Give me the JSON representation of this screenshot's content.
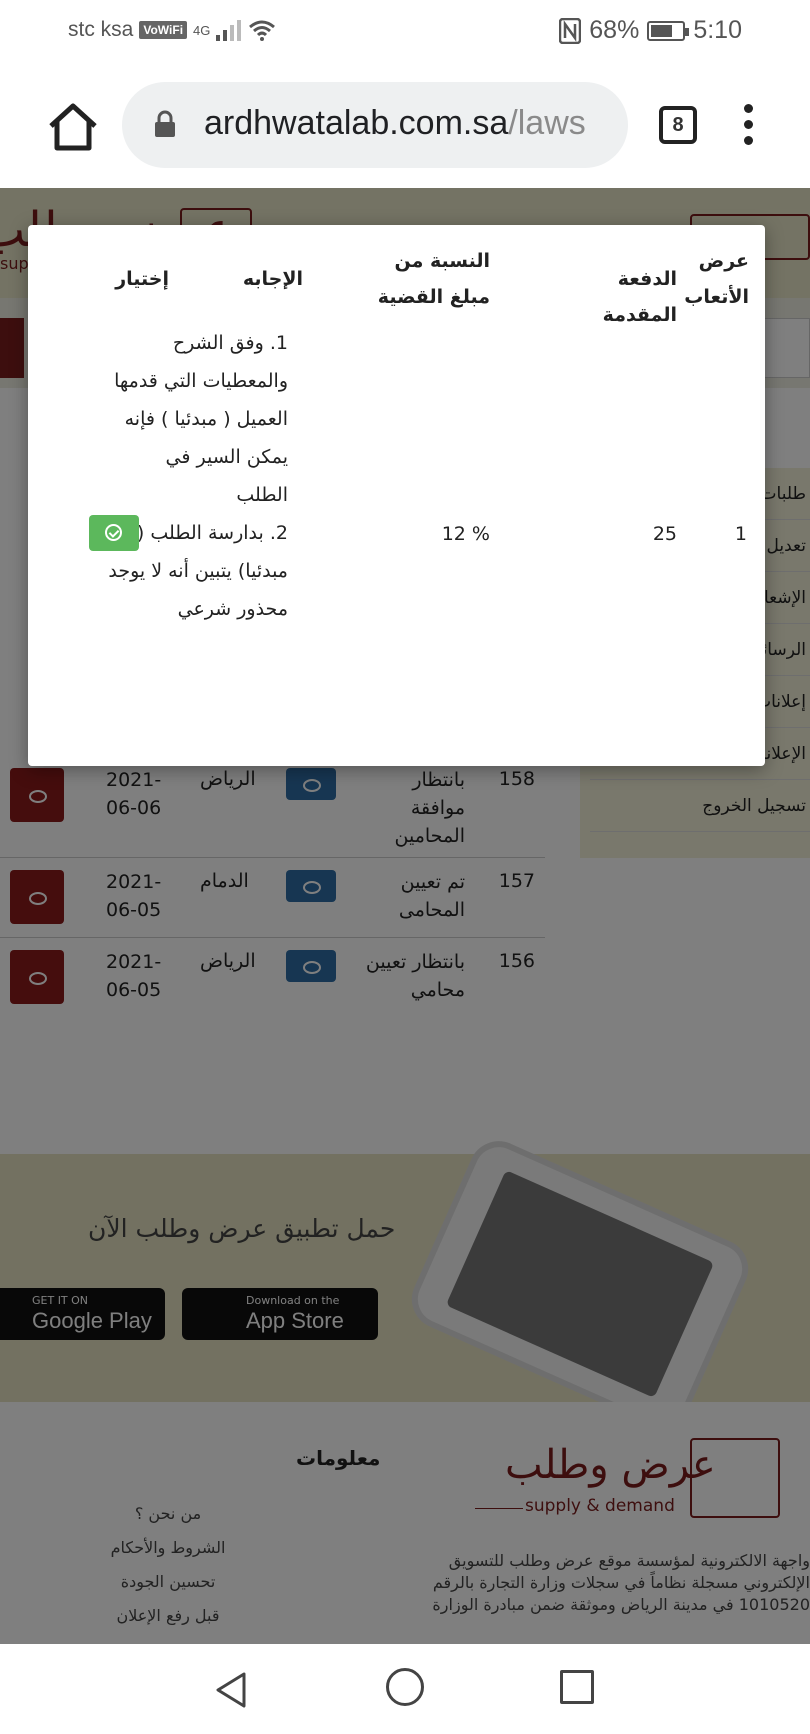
{
  "status_bar": {
    "carrier": "stc ksa",
    "volte": "VoWiFi",
    "network": "4G",
    "battery": "68%",
    "battery_level": 0.68,
    "time": "5:10"
  },
  "browser": {
    "url_main": "ardhwatalab.com.sa",
    "url_rest": "/laws",
    "tab_count": "8"
  },
  "modal": {
    "headers": {
      "fees_offer": "عرض الأتعاب",
      "down_payment": "الدفعة المقدمة",
      "case_percentage": "النسبة من مبلغ القضية",
      "answer": "الإجابه",
      "choose": "إختيار"
    },
    "row": {
      "offer_no": "1",
      "down_payment": "25",
      "percentage": "12 %",
      "answers": [
        "وفق الشرح والمعطيات التي قدمها العميل ( مبدئيا ) فإنه يمكن السير في الطلب",
        "بدارسة الطلب ( مبدئيا) يتبين أنه لا يوجد محذور شرعي"
      ]
    }
  },
  "page": {
    "header_logo": "عرض وطلب",
    "header_sub": "supply",
    "sidebar_items": [
      "طلبات",
      "تعديل",
      "الإشعا",
      "الرسائل",
      "إعلانات",
      "الإعلانات المفضلة",
      "تسجيل الخروج"
    ],
    "table_rows": [
      {
        "num": "158",
        "status": "بانتظار موافقة المحامين",
        "city": "الرياض",
        "date": "2021-06-06"
      },
      {
        "num": "157",
        "status": "تم تعيين المحامى",
        "city": "الدمام",
        "date": "2021-06-05"
      },
      {
        "num": "156",
        "status": "بانتظار تعيين محامي",
        "city": "الرياض",
        "date": "2021-06-05"
      }
    ],
    "app_download_text": "حمل تطبيق عرض وطلب الآن",
    "google_play_small": "GET IT ON",
    "google_play_big": "Google Play",
    "app_store_small": "Download on the",
    "app_store_big": "App Store",
    "footer": {
      "info_title": "معلومات",
      "links": [
        "من نحن ؟",
        "الشروط والأحكام",
        "تحسين الجودة",
        "قبل رفع الإعلان"
      ],
      "logo": "عرض وطلب",
      "logo_sub": "supply & demand",
      "description": "واجهة الالكترونية لمؤسسة موقع عرض وطلب للتسويق الإلكتروني مسجلة نظاماً في سجلات وزارة التجارة بالرقم 1010520 في مدينة الرياض وموثقة ضمن مبادرة الوزارة"
    }
  }
}
